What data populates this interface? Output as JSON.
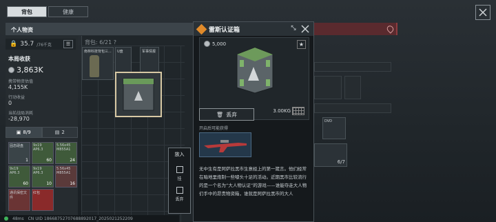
{
  "tabs": [
    {
      "label": "背包"
    },
    {
      "label": "健康"
    }
  ],
  "header": {
    "title": "个人物资"
  },
  "weight": {
    "value": "35.7",
    "max": "/76千克"
  },
  "bag": {
    "label": "背包: 6/21 ?"
  },
  "earnings": {
    "title": "本局收获",
    "amount": "3,863K",
    "carried_label": "携带物资估值",
    "carried_value": "4,155K",
    "action_label": "行动收益",
    "action_value": "0",
    "cost_label": "当前战局消耗",
    "cost_value": "-28,970"
  },
  "subtabs": [
    {
      "label": "8/9"
    },
    {
      "label": "2"
    }
  ],
  "small_items": [
    {
      "name": "固态硬盘",
      "count": "1"
    },
    {
      "name": "9x19 AP6.3",
      "count": "60"
    },
    {
      "name": "5.56x45 M855A1",
      "count": "24"
    },
    {
      "name": "9x19 AP6.3",
      "count": "60"
    },
    {
      "name": "9x19 AP6.3",
      "count": "10"
    },
    {
      "name": "5.56x45 M855A1",
      "count": "16"
    },
    {
      "name": "通讯保密文件",
      "count": ""
    },
    {
      "name": "红包",
      "count": ""
    }
  ],
  "center_items": [
    {
      "name": "南林科技背包三..."
    },
    {
      "name": "U盘"
    },
    {
      "name": "军事情报"
    }
  ],
  "popup": {
    "title": "雷斯认证箱",
    "price": "5,000",
    "weight": "3.00KG",
    "discard": "丢弃",
    "open_label": "开启后可能获得",
    "description": "无中生有是阿萨拉黑市生意经上的第一箴言。他们经常在暗地里炮制一些噱头十足的活动。近期黑市比较流行的是一个名为“大人物认证”的游戏——谁能夺走大人物们手中的昂贵物资箱，谁就是阿萨拉黑市的大人"
  },
  "putctx": {
    "title": "放入",
    "hang": "挂",
    "discard": "丢弃"
  },
  "right_items": [
    {
      "name": "DVD"
    },
    {
      "name": "6/7"
    }
  ],
  "status": {
    "ping": "48ms",
    "uid": "CN UID 18668752707688892017_2025021252209"
  }
}
